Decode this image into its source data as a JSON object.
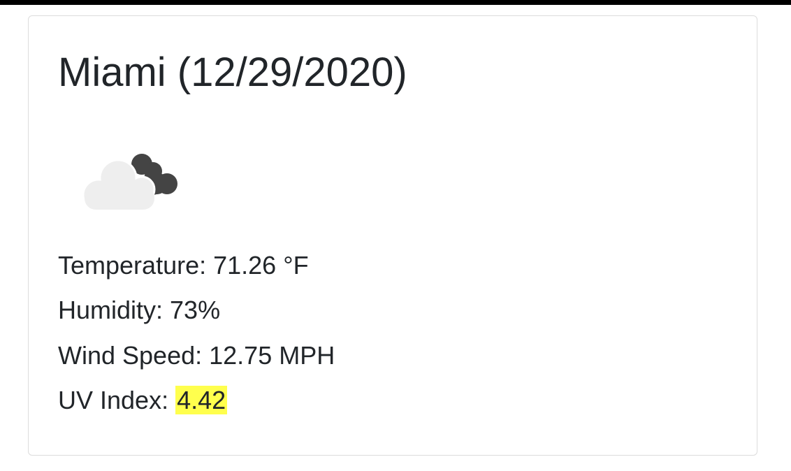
{
  "city_header": "Miami (12/29/2020)",
  "weather": {
    "icon": "cloudy-night-icon",
    "temperature_label": "Temperature: ",
    "temperature_value": "71.26 °F",
    "humidity_label": "Humidity: ",
    "humidity_value": "73%",
    "wind_label": "Wind Speed: ",
    "wind_value": "12.75 MPH",
    "uv_label": "UV Index: ",
    "uv_value": "4.42"
  },
  "colors": {
    "uv_highlight": "#ffff4d",
    "card_border": "#dcdcdc",
    "text": "#212529"
  }
}
